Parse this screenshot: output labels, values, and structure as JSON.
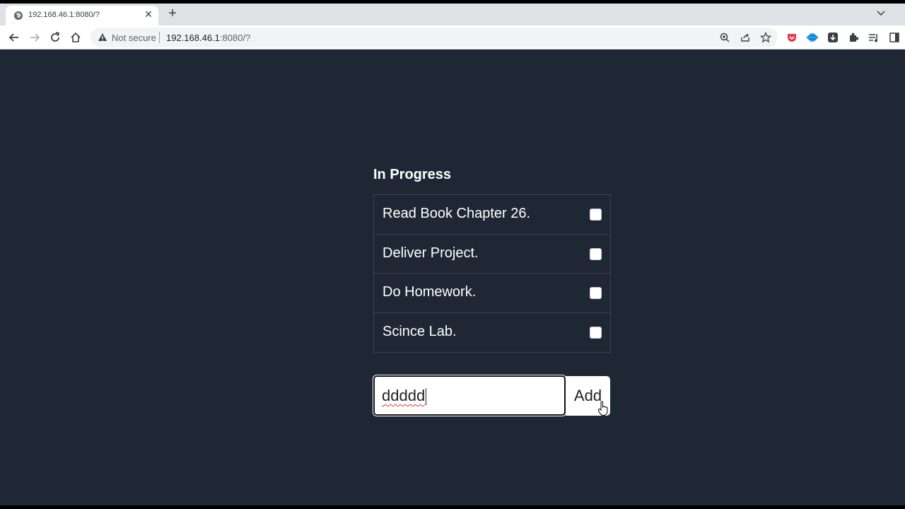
{
  "browser": {
    "tab_title": "192.168.46.1:8080/?",
    "tab_close": "✕",
    "new_tab": "+",
    "security_label": "Not secure",
    "url_host": "192.168.46.1",
    "url_rest": ":8080/?"
  },
  "app": {
    "heading": "In Progress",
    "tasks": [
      {
        "label": "Read Book Chapter 26.",
        "checked": false
      },
      {
        "label": "Deliver Project.",
        "checked": false
      },
      {
        "label": "Do Homework.",
        "checked": false
      },
      {
        "label": "Scince Lab.",
        "checked": false
      }
    ],
    "new_task_value": "ddddd",
    "add_label": "Add"
  },
  "colors": {
    "page_bg": "#1f2735",
    "tabstrip_bg": "#dee1e6"
  }
}
